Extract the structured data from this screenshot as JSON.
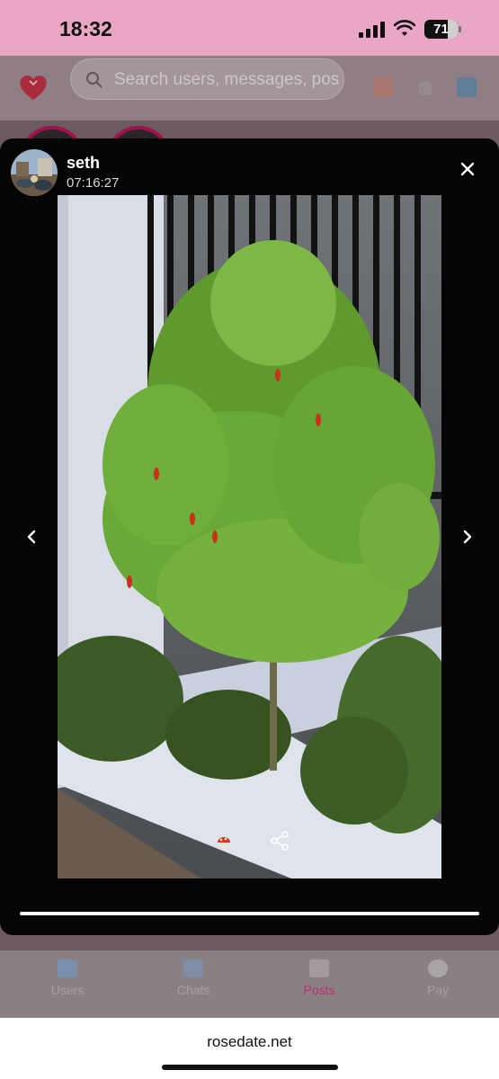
{
  "status_bar": {
    "time": "18:32",
    "battery": "71",
    "battery_level": 0.71
  },
  "app": {
    "search": {
      "placeholder": "Search users, messages, posts"
    },
    "nav": [
      {
        "label": "Users",
        "icon": "users-icon"
      },
      {
        "label": "Chats",
        "icon": "chats-icon"
      },
      {
        "label": "Posts",
        "icon": "posts-icon",
        "active": true
      },
      {
        "label": "Pay",
        "icon": "pay-icon"
      }
    ],
    "colors": {
      "brand_pink": "#eaa6c5",
      "active_nav": "#b0336f"
    }
  },
  "viewer": {
    "username": "seth",
    "time": "07:16:27",
    "close_icon": "close-icon",
    "prev_icon": "chevron-left-icon",
    "next_icon": "chevron-right-icon",
    "share_icon": "share-icon",
    "progress": 1.0
  },
  "browser": {
    "url": "rosedate.net"
  }
}
